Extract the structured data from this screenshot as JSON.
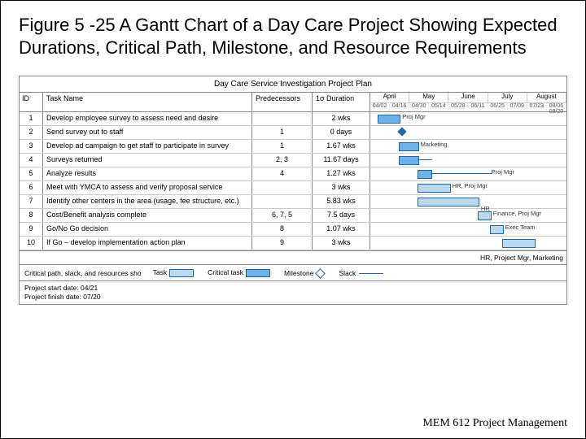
{
  "title": "Figure 5 -25 A Gantt Chart of a Day Care Project Showing Expected Durations, Critical Path, Milestone, and Resource Requirements",
  "footer": "MEM 612 Project Management",
  "chart_data": {
    "type": "gantt",
    "plan_title": "Day Care Service Investigation Project Plan",
    "columns": [
      "ID",
      "Task Name",
      "Predecessors",
      "1σ Duration"
    ],
    "timeline": {
      "months": [
        "April",
        "May",
        "June",
        "July",
        "August"
      ],
      "dates": [
        "04/02",
        "04/16",
        "04/30",
        "05/14",
        "05/28",
        "06/11",
        "06/25",
        "07/09",
        "07/23",
        "08/06 08/20"
      ]
    },
    "tasks": [
      {
        "id": 1,
        "name": "Develop employee survey to assess need and desire",
        "pred": "",
        "dur": "2 wks",
        "start": 5,
        "len": 14,
        "res": "Proj Mgr",
        "crit": false
      },
      {
        "id": 2,
        "name": "Send survey out to staff",
        "pred": "1",
        "dur": "0 days",
        "start": 19,
        "len": 0,
        "res": "",
        "crit": false,
        "milestone": true
      },
      {
        "id": 3,
        "name": "Develop ad campaign to get staff to participate in survey",
        "pred": "1",
        "dur": "1.67 wks",
        "start": 19,
        "len": 12,
        "res": "Marketing",
        "crit": false
      },
      {
        "id": 4,
        "name": "Surveys returned",
        "pred": "2, 3",
        "dur": "11.67 days",
        "start": 19,
        "len": 12,
        "res": "",
        "crit": false,
        "slack": 10
      },
      {
        "id": 5,
        "name": "Analyze results",
        "pred": "4",
        "dur": "1.27 wks",
        "start": 31,
        "len": 9,
        "res": "Proj Mgr",
        "crit": false,
        "slack": 40,
        "lblx": 80
      },
      {
        "id": 6,
        "name": "Meet with YMCA to assess and verify proposal service",
        "pred": "",
        "dur": "3 wks",
        "start": 31,
        "len": 21,
        "res": "HR, Proj Mgr",
        "crit": true
      },
      {
        "id": 7,
        "name": "Identify other centers in the area (usage, fee structure, etc.)",
        "pred": "",
        "dur": "5.83 wks",
        "start": 31,
        "len": 40,
        "res": "HR",
        "crit": true,
        "lbly": 12
      },
      {
        "id": 8,
        "name": "Cost/Benefit analysis complete",
        "pred": "6, 7, 5",
        "dur": "7.5 days",
        "start": 71,
        "len": 8,
        "res": "Finance, Proj Mgr",
        "crit": true
      },
      {
        "id": 9,
        "name": "Go/No Go decision",
        "pred": "8",
        "dur": "1.07 wks",
        "start": 79,
        "len": 8,
        "res": "Exec Team",
        "crit": true
      },
      {
        "id": 10,
        "name": "If Go – develop implementation action plan",
        "pred": "9",
        "dur": "3 wks",
        "start": 87,
        "len": 21,
        "res": "",
        "crit": true
      }
    ],
    "footer_resources": "HR, Project Mgr, Marketing",
    "legend": {
      "label": "Critical path, slack, and resources sho",
      "task": "Task",
      "critical": "Critical task",
      "milestone": "Milestone",
      "slack": "Slack"
    },
    "project_start": "Project start date: 04/21",
    "project_finish": "Project finish date: 07/20"
  }
}
